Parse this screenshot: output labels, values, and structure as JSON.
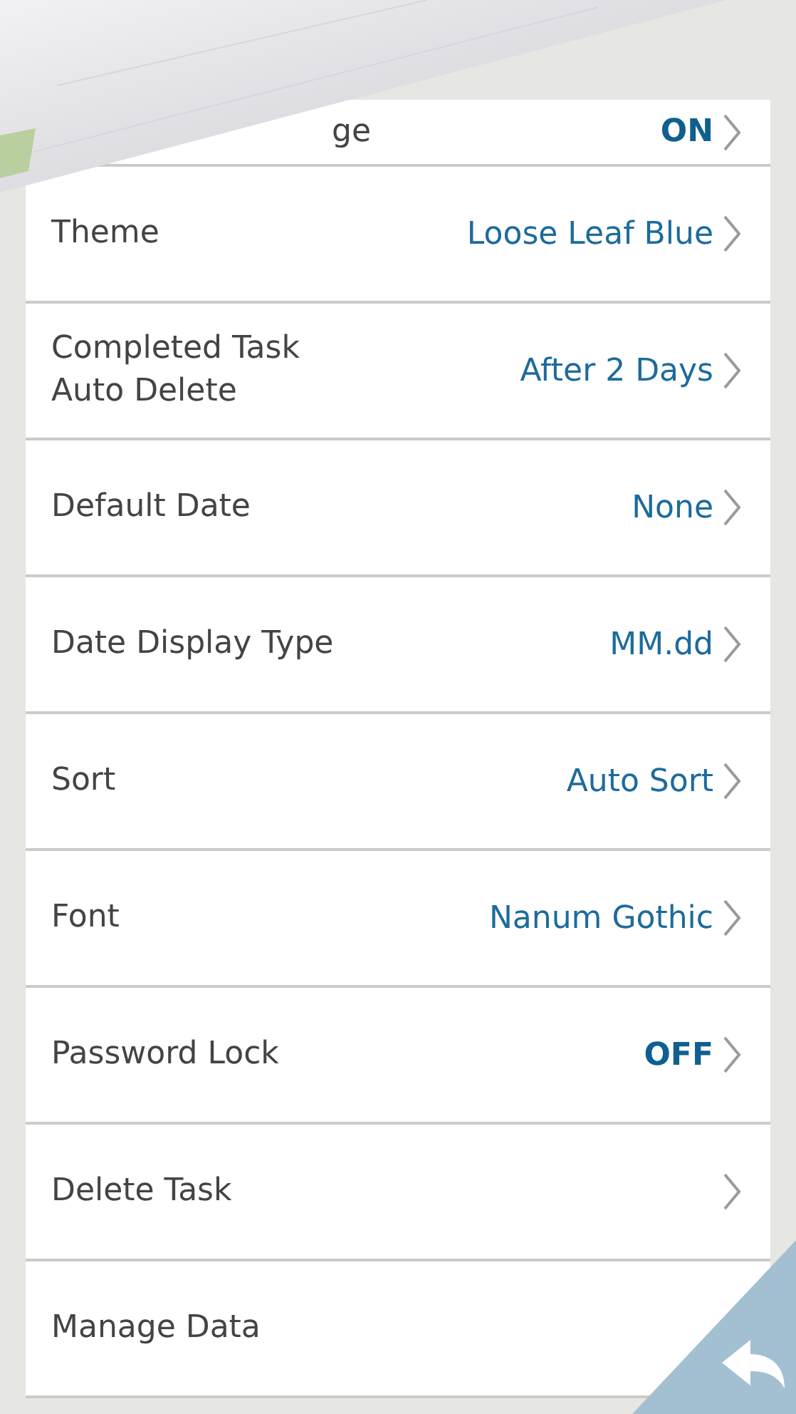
{
  "settings": [
    {
      "kind": "clipped",
      "label": "ge",
      "value": "ON",
      "emphasis": true,
      "chevron": true
    },
    {
      "kind": "row",
      "label": "Theme",
      "value": "Loose Leaf Blue",
      "emphasis": false,
      "chevron": true
    },
    {
      "kind": "row",
      "label": "Completed Task\nAuto Delete",
      "value": "After 2 Days",
      "emphasis": false,
      "chevron": true
    },
    {
      "kind": "row",
      "label": "Default Date",
      "value": "None",
      "emphasis": false,
      "chevron": true
    },
    {
      "kind": "row",
      "label": "Date Display Type",
      "value": "MM.dd",
      "emphasis": false,
      "chevron": true
    },
    {
      "kind": "row",
      "label": "Sort",
      "value": "Auto Sort",
      "emphasis": false,
      "chevron": true
    },
    {
      "kind": "row",
      "label": "Font",
      "value": "Nanum Gothic",
      "emphasis": false,
      "chevron": true
    },
    {
      "kind": "row",
      "label": "Password Lock",
      "value": "OFF",
      "emphasis": true,
      "chevron": true
    },
    {
      "kind": "row",
      "label": "Delete Task",
      "chevron": true
    },
    {
      "kind": "row",
      "label": "Manage Data",
      "chevron": false
    }
  ]
}
